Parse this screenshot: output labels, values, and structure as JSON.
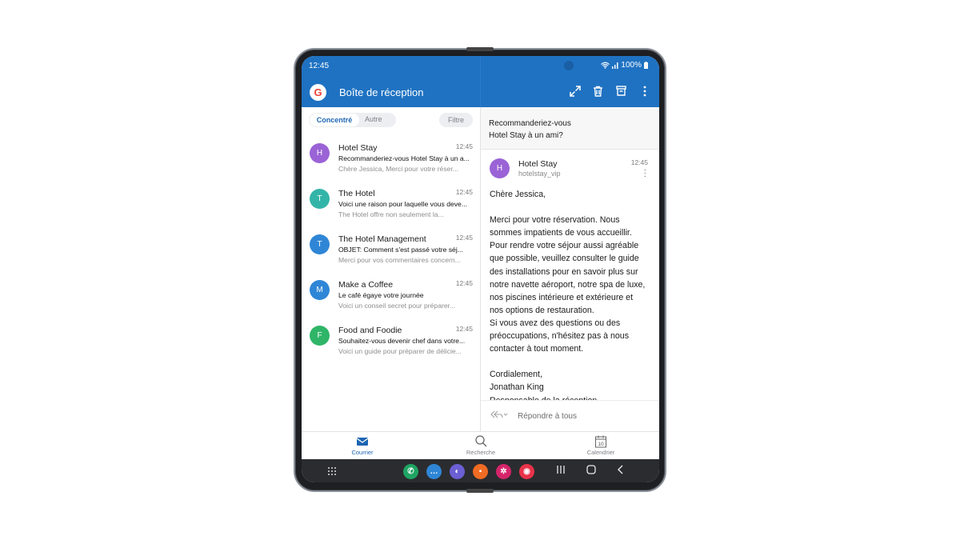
{
  "status": {
    "time": "12:45",
    "battery": "100%"
  },
  "appbar": {
    "title": "Boîte de réception",
    "account_icon": "google-icon",
    "actions": [
      "expand-icon",
      "trash-icon",
      "archive-icon",
      "more-vert-icon"
    ]
  },
  "tabs": {
    "focused": "Concentré",
    "other": "Autre",
    "filter": "Filtre"
  },
  "mails": [
    {
      "initial": "H",
      "color": "#9a63d6",
      "from": "Hotel Stay",
      "time": "12:45",
      "subject": "Recommanderiez-vous Hotel Stay à un a...",
      "preview": "Chère Jessica, Merci pour votre réser..."
    },
    {
      "initial": "T",
      "color": "#32b5a8",
      "from": "The Hotel",
      "time": "12:45",
      "subject": "Voici une raison pour laquelle vous deve...",
      "preview": "The Hotel offre non seulement la..."
    },
    {
      "initial": "T",
      "color": "#2f86d6",
      "from": "The Hotel Management",
      "time": "12:45",
      "subject": "OBJET: Comment s'est passé votre séj...",
      "preview": "Merci pour vos commentaires concern..."
    },
    {
      "initial": "M",
      "color": "#2f86d6",
      "from": "Make a Coffee",
      "time": "12:45",
      "subject": "Le café égaye votre journée",
      "preview": "Voici un conseil secret pour préparer..."
    },
    {
      "initial": "F",
      "color": "#2fb567",
      "from": "Food and Foodie",
      "time": "12:45",
      "subject": "Souhaitez-vous devenir chef dans votre...",
      "preview": "Voici un guide pour préparer de délicie..."
    }
  ],
  "reader": {
    "subject_line1": "Recommanderiez-vous",
    "subject_line2": "Hotel Stay à un ami?",
    "initial": "H",
    "from": "Hotel Stay",
    "address": "hotelstay_vip",
    "time": "12:45",
    "body": [
      "Chère Jessica,",
      "",
      "Merci pour votre réservation. Nous",
      "sommes impatients de vous accueillir.",
      "Pour rendre votre séjour aussi agréable",
      "que possible, veuillez consulter le guide",
      "des installations pour en savoir plus sur",
      "notre navette aéroport, notre spa de luxe,",
      "nos piscines intérieure et extérieure et",
      "nos options de restauration.",
      "Si vous avez des questions ou des",
      "préoccupations, n'hésitez pas à nous",
      "contacter à tout moment.",
      "",
      "Cordialement,",
      "Jonathan King",
      "Responsable de la réception"
    ],
    "reply_label": "Répondre à tous"
  },
  "bottom_nav": [
    {
      "label": "Courrier",
      "icon": "mail-icon",
      "active": true
    },
    {
      "label": "Recherche",
      "icon": "search-icon",
      "active": false
    },
    {
      "label": "Calendrier",
      "icon": "calendar-icon",
      "active": false,
      "day": "10"
    }
  ],
  "dock": [
    {
      "name": "phone-app-icon",
      "color": "#1fa463",
      "glyph": "✆"
    },
    {
      "name": "messages-app-icon",
      "color": "#2f86d6",
      "glyph": "…"
    },
    {
      "name": "browser-app-icon",
      "color": "#6b5fd3",
      "glyph": "◐"
    },
    {
      "name": "notes-app-icon",
      "color": "#f06b23",
      "glyph": "▪"
    },
    {
      "name": "bixby-app-icon",
      "color": "#d6246a",
      "glyph": "✲"
    },
    {
      "name": "camera-app-icon",
      "color": "#e8334a",
      "glyph": "◉"
    }
  ]
}
